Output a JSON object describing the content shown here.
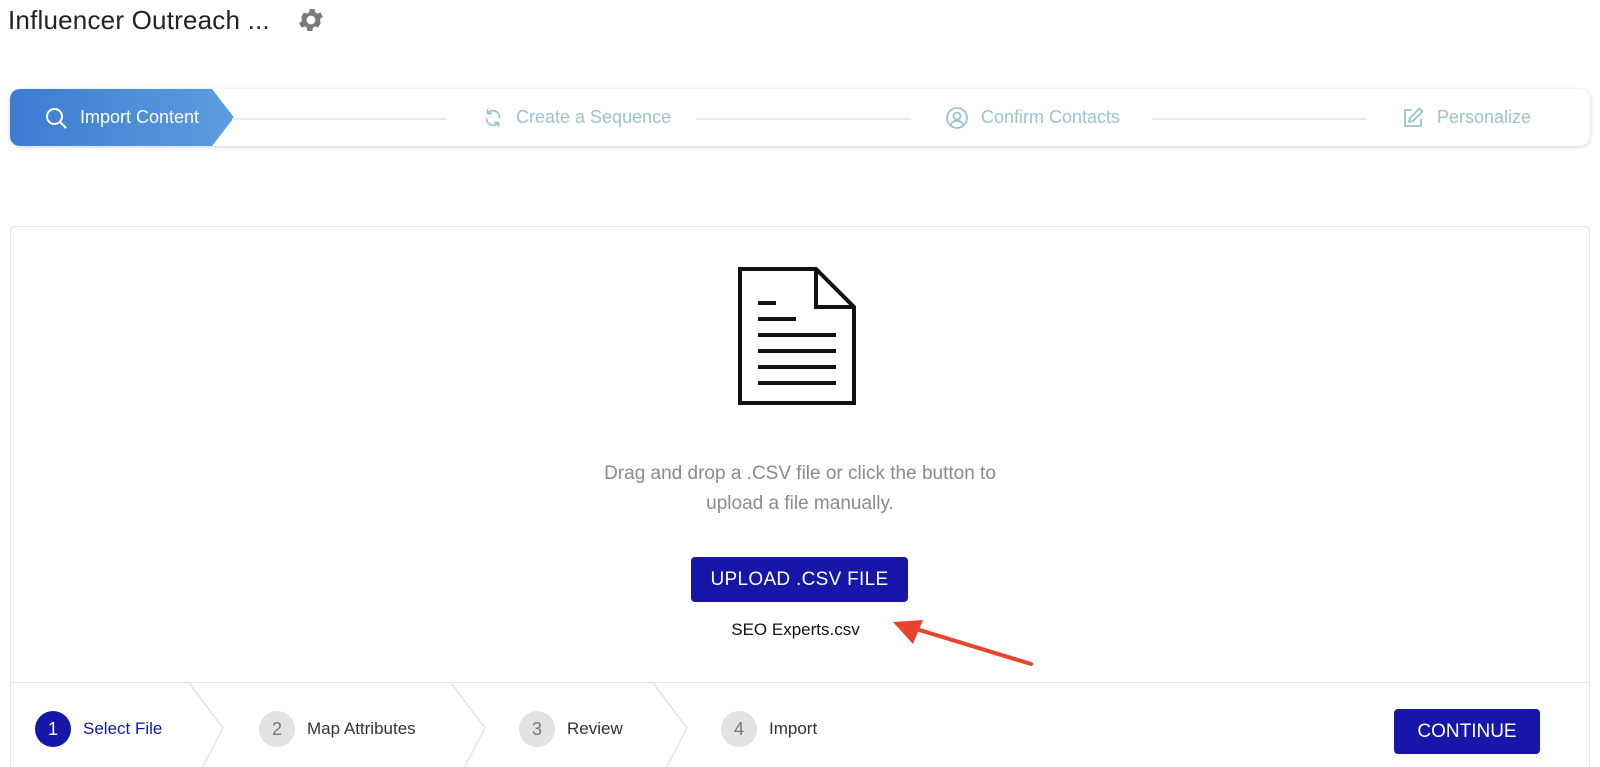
{
  "header": {
    "title": "Influencer Outreach ...",
    "settings_icon": "gear-icon"
  },
  "stepper": {
    "steps": [
      {
        "label": "Import Content",
        "icon": "search-icon",
        "active": true
      },
      {
        "label": "Create a Sequence",
        "icon": "refresh-icon",
        "active": false
      },
      {
        "label": "Confirm Contacts",
        "icon": "user-circle-icon",
        "active": false
      },
      {
        "label": "Personalize",
        "icon": "edit-icon",
        "active": false
      }
    ]
  },
  "upload": {
    "icon": "document-icon",
    "instructions_line1": "Drag and drop a .CSV file or click the button to",
    "instructions_line2": "upload a file manually.",
    "button_label": "UPLOAD .CSV FILE",
    "file_name": "SEO Experts.csv"
  },
  "wizard": {
    "steps": [
      {
        "number": "1",
        "label": "Select File",
        "active": true
      },
      {
        "number": "2",
        "label": "Map Attributes",
        "active": false
      },
      {
        "number": "3",
        "label": "Review",
        "active": false
      },
      {
        "number": "4",
        "label": "Import",
        "active": false
      }
    ],
    "continue_label": "CONTINUE"
  },
  "colors": {
    "primary": "#1616a8",
    "active_step": "#4a8ad4",
    "inactive_step": "#9cc3cf",
    "annotation_arrow": "#e8432b"
  }
}
